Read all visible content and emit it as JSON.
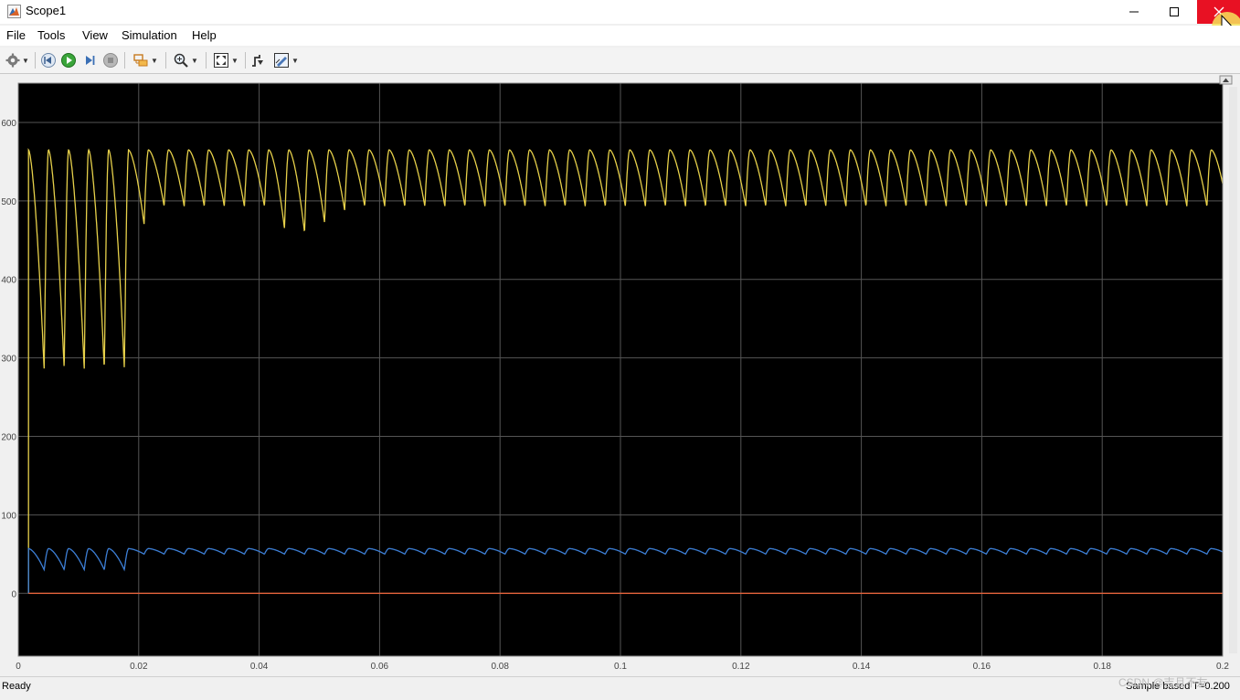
{
  "window": {
    "title": "Scope1",
    "accent_close": "#e81123"
  },
  "menu": {
    "items": [
      "File",
      "Tools",
      "View",
      "Simulation",
      "Help"
    ]
  },
  "toolbar": {
    "icons": [
      "gear-icon",
      "step-back-icon",
      "run-icon",
      "step-forward-icon",
      "stop-icon",
      "highlight-icon",
      "zoom-icon",
      "fit-to-view-icon",
      "trigger-icon",
      "style-icon"
    ]
  },
  "status": {
    "left": "Ready",
    "right": "Sample based T=0.200"
  },
  "watermark": "CSDN @吉且不友",
  "chart_data": {
    "type": "line",
    "xlim": [
      0,
      0.2
    ],
    "ylim": [
      -80,
      650
    ],
    "x_ticks": [
      0,
      0.02,
      0.04,
      0.06,
      0.08,
      0.1,
      0.12,
      0.14,
      0.16,
      0.18,
      0.2
    ],
    "x_tick_labels": [
      "0",
      "0.02",
      "0.04",
      "0.06",
      "0.08",
      "0.1",
      "0.12",
      "0.14",
      "0.16",
      "0.18",
      "0.2"
    ],
    "y_ticks": [
      0,
      100,
      200,
      300,
      400,
      500,
      600
    ],
    "y_tick_labels": [
      "0",
      "100",
      "200",
      "300",
      "400",
      "500",
      "600"
    ],
    "grid": true,
    "background": "#000000",
    "grid_color": "#555555",
    "series": [
      {
        "color": "#e6d04a",
        "start_x": 0.0017,
        "peak": 565,
        "transient_end": 0.0183,
        "transient_period": 0.00333,
        "transient_trough": 285,
        "steady_period": 0.00333,
        "steady_trough": 493,
        "dip_events": [
          [
            0.0194,
            470
          ],
          [
            0.0433,
            465
          ],
          [
            0.0467,
            460
          ],
          [
            0.05,
            472
          ],
          [
            0.0533,
            488
          ]
        ]
      },
      {
        "color": "#3d7fd6",
        "start_x": 0.0017,
        "peak": 57,
        "transient_end": 0.0183,
        "transient_period": 0.00333,
        "transient_trough": 30,
        "steady_period": 0.00333,
        "steady_trough": 50,
        "dip_events": []
      },
      {
        "color": "#e0603a",
        "constant": 0
      }
    ]
  }
}
